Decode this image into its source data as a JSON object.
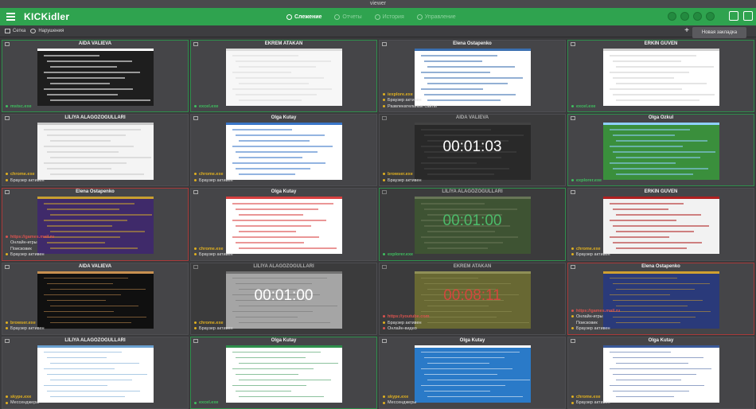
{
  "window": {
    "title": "viewer"
  },
  "app": {
    "logo": "KICKidler",
    "nav": [
      {
        "label": "Слежение",
        "active": true
      },
      {
        "label": "Отчеты",
        "active": false
      },
      {
        "label": "История",
        "active": false
      },
      {
        "label": "Управление",
        "active": false
      }
    ]
  },
  "toolbar": {
    "grid_label": "Сетка",
    "violations_label": "Нарушения",
    "plus": "+",
    "new_tab": "Новая закладка"
  },
  "colors": {
    "accent": "#2fa34f",
    "ok": "#2e8f4c",
    "violation": "#a83a3a",
    "process_ok": "#3fbf5f",
    "process_warn": "#e0b020",
    "process_bad": "#d9534f"
  },
  "tiles": [
    {
      "name": "AIDA VALIEVA",
      "border": "g",
      "screen": "win",
      "items": [
        {
          "text": "mstsc.exe",
          "kind": "proc",
          "tone": "ok"
        }
      ]
    },
    {
      "name": "EKREM ATAKAN",
      "border": "g",
      "screen": "table",
      "items": [
        {
          "text": "excel.exe",
          "kind": "proc",
          "tone": "ok"
        }
      ]
    },
    {
      "name": "Elena Ostapenko",
      "border": "y",
      "screen": "web",
      "items": [
        {
          "text": "iexplore.exe",
          "kind": "proc",
          "tone": "warn"
        },
        {
          "text": "Браузер активен",
          "kind": "cat",
          "tone": "warn"
        },
        {
          "text": "Развлекательные сайты",
          "kind": "cat",
          "tone": "warn"
        }
      ]
    },
    {
      "name": "ERKİN GÜVEN",
      "border": "g",
      "screen": "sheet",
      "items": [
        {
          "text": "excel.exe",
          "kind": "proc",
          "tone": "ok"
        }
      ]
    },
    {
      "name": "LİLİYA ALAGÖZOĞULLARI",
      "border": "y",
      "screen": "doc",
      "items": [
        {
          "text": "chrome.exe",
          "kind": "proc",
          "tone": "warn"
        },
        {
          "text": "Браузер активен",
          "kind": "cat",
          "tone": "warn"
        }
      ]
    },
    {
      "name": "Olga Kutay",
      "border": "y",
      "screen": "site",
      "items": [
        {
          "text": "chrome.exe",
          "kind": "proc",
          "tone": "warn"
        },
        {
          "text": "Браузер активен",
          "kind": "cat",
          "tone": "warn"
        }
      ]
    },
    {
      "name": "AIDA VALIEVA",
      "border": "y",
      "screen": "dark",
      "timer": "00:01:03",
      "timer_tone": "white",
      "items": [
        {
          "text": "browser.exe",
          "kind": "proc",
          "tone": "warn"
        },
        {
          "text": "Браузер активен",
          "kind": "cat",
          "tone": "warn"
        }
      ]
    },
    {
      "name": "Olga Ozkul",
      "border": "g",
      "screen": "desktop",
      "items": [
        {
          "text": "explorer.exe",
          "kind": "proc",
          "tone": "ok"
        }
      ]
    },
    {
      "name": "Elena Ostapenko",
      "border": "r",
      "screen": "game",
      "items": [
        {
          "text": "https://games.mail.ru",
          "kind": "proc",
          "tone": "bad"
        },
        {
          "text": "Онлайн-игры",
          "kind": "cat",
          "tone": "none"
        },
        {
          "text": "Поисковик",
          "kind": "cat",
          "tone": "none"
        },
        {
          "text": "Браузер активен",
          "kind": "cat",
          "tone": "warn"
        }
      ]
    },
    {
      "name": "Olga Kutay",
      "border": "y",
      "screen": "catalog",
      "items": [
        {
          "text": "chrome.exe",
          "kind": "proc",
          "tone": "warn"
        },
        {
          "text": "Браузер активен",
          "kind": "cat",
          "tone": "warn"
        }
      ]
    },
    {
      "name": "LİLİYA ALAGÖZOĞULLARI",
      "border": "g",
      "screen": "photo",
      "timer": "00:01:00",
      "timer_tone": "green",
      "items": [
        {
          "text": "explorer.exe",
          "kind": "proc",
          "tone": "ok"
        }
      ]
    },
    {
      "name": "ERKİN GÜVEN",
      "border": "y",
      "screen": "news",
      "items": [
        {
          "text": "chrome.exe",
          "kind": "proc",
          "tone": "warn"
        },
        {
          "text": "Браузер активен",
          "kind": "cat",
          "tone": "warn"
        }
      ]
    },
    {
      "name": "AIDA VALIEVA",
      "border": "y",
      "screen": "video",
      "items": [
        {
          "text": "browser.exe",
          "kind": "proc",
          "tone": "warn"
        },
        {
          "text": "Браузер активен",
          "kind": "cat",
          "tone": "warn"
        }
      ]
    },
    {
      "name": "LİLİYA ALAGÖZOĞULLARI",
      "border": "y",
      "screen": "article",
      "timer": "00:01:00",
      "timer_tone": "white",
      "items": [
        {
          "text": "chrome.exe",
          "kind": "proc",
          "tone": "warn"
        },
        {
          "text": "Браузер активен",
          "kind": "cat",
          "tone": "warn"
        }
      ]
    },
    {
      "name": "EKREM ATAKAN",
      "border": "y",
      "screen": "olive",
      "timer": "00:08:11",
      "timer_tone": "red",
      "items": [
        {
          "text": "https://youtube.com",
          "kind": "proc",
          "tone": "bad"
        },
        {
          "text": "Браузер активен",
          "kind": "cat",
          "tone": "warn"
        },
        {
          "text": "Онлайн-видео",
          "kind": "cat",
          "tone": "bad"
        }
      ]
    },
    {
      "name": "Elena Ostapenko",
      "border": "r",
      "screen": "game2",
      "items": [
        {
          "text": "https://games.mail.ru",
          "kind": "proc",
          "tone": "bad"
        },
        {
          "text": "Онлайн-игры",
          "kind": "cat",
          "tone": "warn"
        },
        {
          "text": "Поисковик",
          "kind": "cat",
          "tone": "none"
        },
        {
          "text": "Браузер активен",
          "kind": "cat",
          "tone": "warn"
        }
      ]
    },
    {
      "name": "LİLİYA ALAGÖZOĞULLARI",
      "border": "y",
      "screen": "social",
      "items": [
        {
          "text": "skype.exe",
          "kind": "proc",
          "tone": "warn"
        },
        {
          "text": "Мессенджеры",
          "kind": "cat",
          "tone": "warn"
        }
      ]
    },
    {
      "name": "Olga Kutay",
      "border": "g",
      "screen": "sheet2",
      "items": [
        {
          "text": "excel.exe",
          "kind": "proc",
          "tone": "ok"
        }
      ]
    },
    {
      "name": "Olga Kutay",
      "border": "y",
      "screen": "bluedesk",
      "items": [
        {
          "text": "skype.exe",
          "kind": "proc",
          "tone": "warn"
        },
        {
          "text": "Мессенджеры",
          "kind": "cat",
          "tone": "warn"
        }
      ]
    },
    {
      "name": "Olga Kutay",
      "border": "y",
      "screen": "profile",
      "items": [
        {
          "text": "chrome.exe",
          "kind": "proc",
          "tone": "warn"
        },
        {
          "text": "Браузер активен",
          "kind": "cat",
          "tone": "warn"
        }
      ]
    }
  ]
}
